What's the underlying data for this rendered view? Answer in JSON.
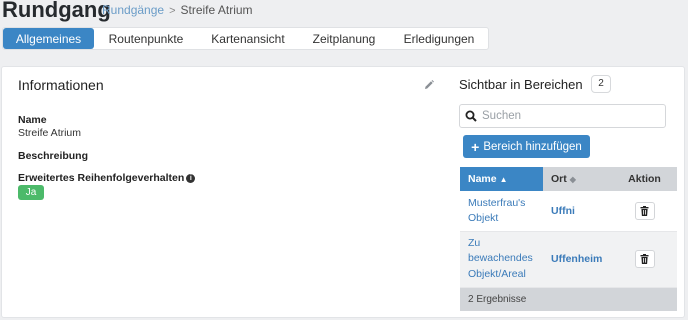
{
  "header": {
    "title": "Rundgang",
    "breadcrumb": {
      "parent": "Rundgänge",
      "separator": ">",
      "current": "Streife Atrium"
    }
  },
  "tabs": [
    {
      "label": "Allgemeines",
      "active": true
    },
    {
      "label": "Routenpunkte",
      "active": false
    },
    {
      "label": "Kartenansicht",
      "active": false
    },
    {
      "label": "Zeitplanung",
      "active": false
    },
    {
      "label": "Erledigungen",
      "active": false
    }
  ],
  "info": {
    "title": "Informationen",
    "name_label": "Name",
    "name_value": "Streife Atrium",
    "description_label": "Beschreibung",
    "order_label": "Erweitertes Reihenfolgeverhalten",
    "order_value": "Ja"
  },
  "visibility": {
    "title": "Sichtbar in Bereichen",
    "count": "2",
    "search_placeholder": "Suchen",
    "add_button": "Bereich hinzufügen",
    "columns": {
      "name": "Name",
      "ort": "Ort",
      "aktion": "Aktion"
    },
    "rows": [
      {
        "name": "Musterfrau's Objekt",
        "ort": "Uffni"
      },
      {
        "name": "Zu bewachendes Objekt/Areal",
        "ort": "Uffenheim"
      }
    ],
    "result_count": "2 Ergebnisse"
  },
  "colors": {
    "accent": "#3b86c5",
    "success": "#4cba6a",
    "background": "#eeeff1"
  }
}
